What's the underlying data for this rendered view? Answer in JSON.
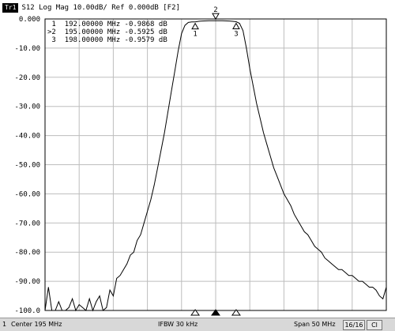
{
  "title": {
    "trace_badge": "Tr1",
    "trace_info": "S12 Log Mag 10.00dB/ Ref 0.000dB [F2]"
  },
  "y_axis_labels": [
    "0.000",
    "-10.00",
    "-20.00",
    "-30.00",
    "-40.00",
    "-50.00",
    "-60.00",
    "-70.00",
    "-80.00",
    "-90.00",
    "-100.0"
  ],
  "markers": [
    {
      "prefix": " ",
      "num": "1",
      "freq": "192.00000 MHz",
      "value": "-0.9868 dB"
    },
    {
      "prefix": ">",
      "num": "2",
      "freq": "195.00000 MHz",
      "value": "-0.5925 dB"
    },
    {
      "prefix": " ",
      "num": "3",
      "freq": "198.00000 MHz",
      "value": "-0.9579 dB"
    }
  ],
  "marker_tags": [
    "1",
    "2",
    "3"
  ],
  "status": {
    "channel": "1",
    "center": "Center 195 MHz",
    "ifbw": "IFBW 30 kHz",
    "span": "Span 50 MHz",
    "sweep": "16/16",
    "cl": "Cl"
  },
  "chart_data": {
    "type": "line",
    "xlabel": "",
    "ylabel": "",
    "xlim": [
      170,
      220
    ],
    "ylim": [
      -100,
      0
    ],
    "grid": true,
    "series": [
      {
        "x": [
          170,
          170.5,
          171,
          171.5,
          172,
          172.5,
          173,
          173.5,
          174,
          174.5,
          175,
          175.5,
          176,
          176.5,
          177,
          177.5,
          178,
          178.5,
          179,
          179.5,
          180,
          180.5,
          181,
          181.5,
          182,
          182.5,
          183,
          183.5,
          184,
          184.5,
          185,
          185.5,
          186,
          186.5,
          187,
          187.5,
          188,
          188.5,
          189,
          189.5,
          190,
          190.5,
          191,
          191.5,
          192,
          192.5,
          193,
          194,
          195,
          196,
          197,
          197.5,
          198,
          198.5,
          199,
          199.5,
          200,
          200.5,
          201,
          201.5,
          202,
          202.5,
          203,
          203.5,
          204,
          204.5,
          205,
          205.5,
          206,
          206.5,
          207,
          207.5,
          208,
          208.5,
          209,
          209.5,
          210,
          210.5,
          211,
          211.5,
          212,
          212.5,
          213,
          213.5,
          214,
          214.5,
          215,
          215.5,
          216,
          216.5,
          217,
          217.5,
          218,
          218.5,
          219,
          219.5,
          220
        ],
        "y": [
          -100,
          -92,
          -100,
          -100,
          -97,
          -100,
          -100,
          -99,
          -96,
          -100,
          -98,
          -99,
          -100,
          -96,
          -100,
          -97,
          -95,
          -100,
          -99,
          -93,
          -95,
          -89,
          -88,
          -86,
          -84,
          -81,
          -80,
          -76,
          -74,
          -70,
          -66,
          -62,
          -57,
          -51,
          -45,
          -39,
          -32,
          -25,
          -18,
          -11,
          -5,
          -2.2,
          -1.2,
          -1.0,
          -0.99,
          -0.8,
          -0.7,
          -0.6,
          -0.59,
          -0.6,
          -0.7,
          -0.8,
          -0.96,
          -1.5,
          -4,
          -10,
          -17,
          -23,
          -29,
          -34,
          -39,
          -43,
          -47,
          -51,
          -54,
          -57,
          -60,
          -62,
          -64,
          -67,
          -69,
          -71,
          -73,
          -74,
          -76,
          -78,
          -79,
          -80,
          -82,
          -83,
          -84,
          -85,
          -86,
          -86,
          -87,
          -88,
          -88,
          -89,
          -90,
          -90,
          -91,
          -92,
          -92,
          -93,
          -95,
          -96,
          -92
        ]
      }
    ],
    "markers_x": [
      192,
      195,
      198
    ]
  }
}
